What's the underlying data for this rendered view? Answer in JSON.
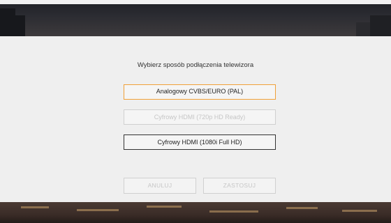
{
  "dialog": {
    "title": "Wybierz sposób podłączenia telewizora",
    "options": [
      {
        "label": "Analogowy CVBS/EURO (PAL)",
        "state": "selected"
      },
      {
        "label": "Cyfrowy HDMI (720p HD Ready)",
        "state": "disabled"
      },
      {
        "label": "Cyfrowy HDMI (1080i Full HD)",
        "state": "normal"
      }
    ],
    "buttons": {
      "cancel_label": "ANULUJ",
      "apply_label": "ZASTOSUJ"
    }
  },
  "colors": {
    "focus_border": "#f0a038",
    "panel_background": "#efefef",
    "disabled_text": "#c6c6c6"
  }
}
